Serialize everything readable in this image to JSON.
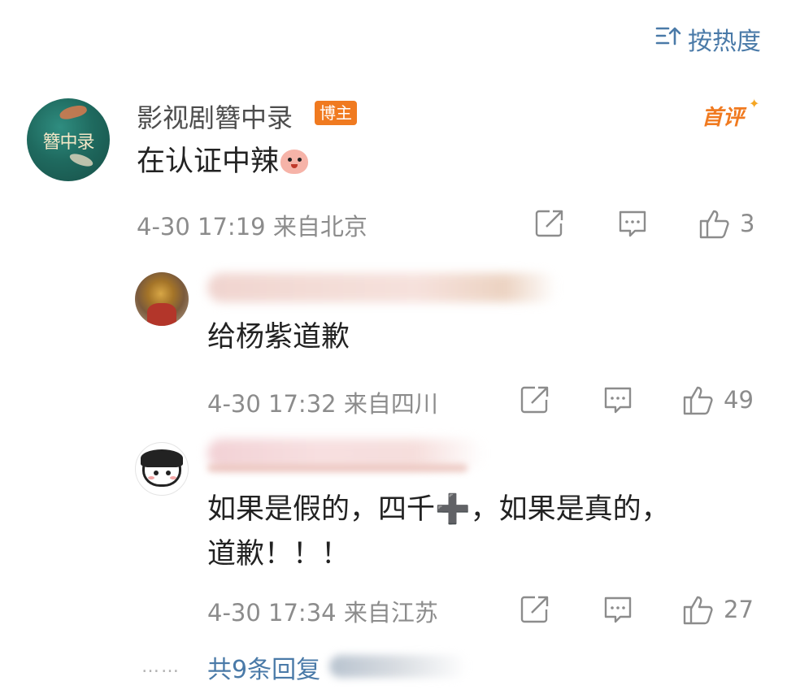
{
  "sort": {
    "label": "按热度",
    "icon": "sort-icon"
  },
  "main_comment": {
    "author": "影视剧簪中录",
    "avatar_text": "簪中录",
    "badge": "博主",
    "first_tag": "首评",
    "text": "在认证中辣",
    "emoji": "shy-face-emoji",
    "time": "4-30 17:19",
    "location": "来自北京",
    "likes": "3"
  },
  "replies": [
    {
      "text": "给杨紫道歉",
      "time": "4-30 17:32",
      "location": "来自四川",
      "likes": "49"
    },
    {
      "text_line1": "如果是假的，四千➕，如果是真的，",
      "text_line2": "道歉！！！",
      "time": "4-30 17:34",
      "location": "来自江苏",
      "likes": "27"
    }
  ],
  "footer": {
    "dots": "……",
    "more_label": "共9条回复"
  },
  "colors": {
    "link_blue": "#4a7aa8",
    "badge_orange": "#f07a20",
    "meta_gray": "#8c8c8c"
  }
}
